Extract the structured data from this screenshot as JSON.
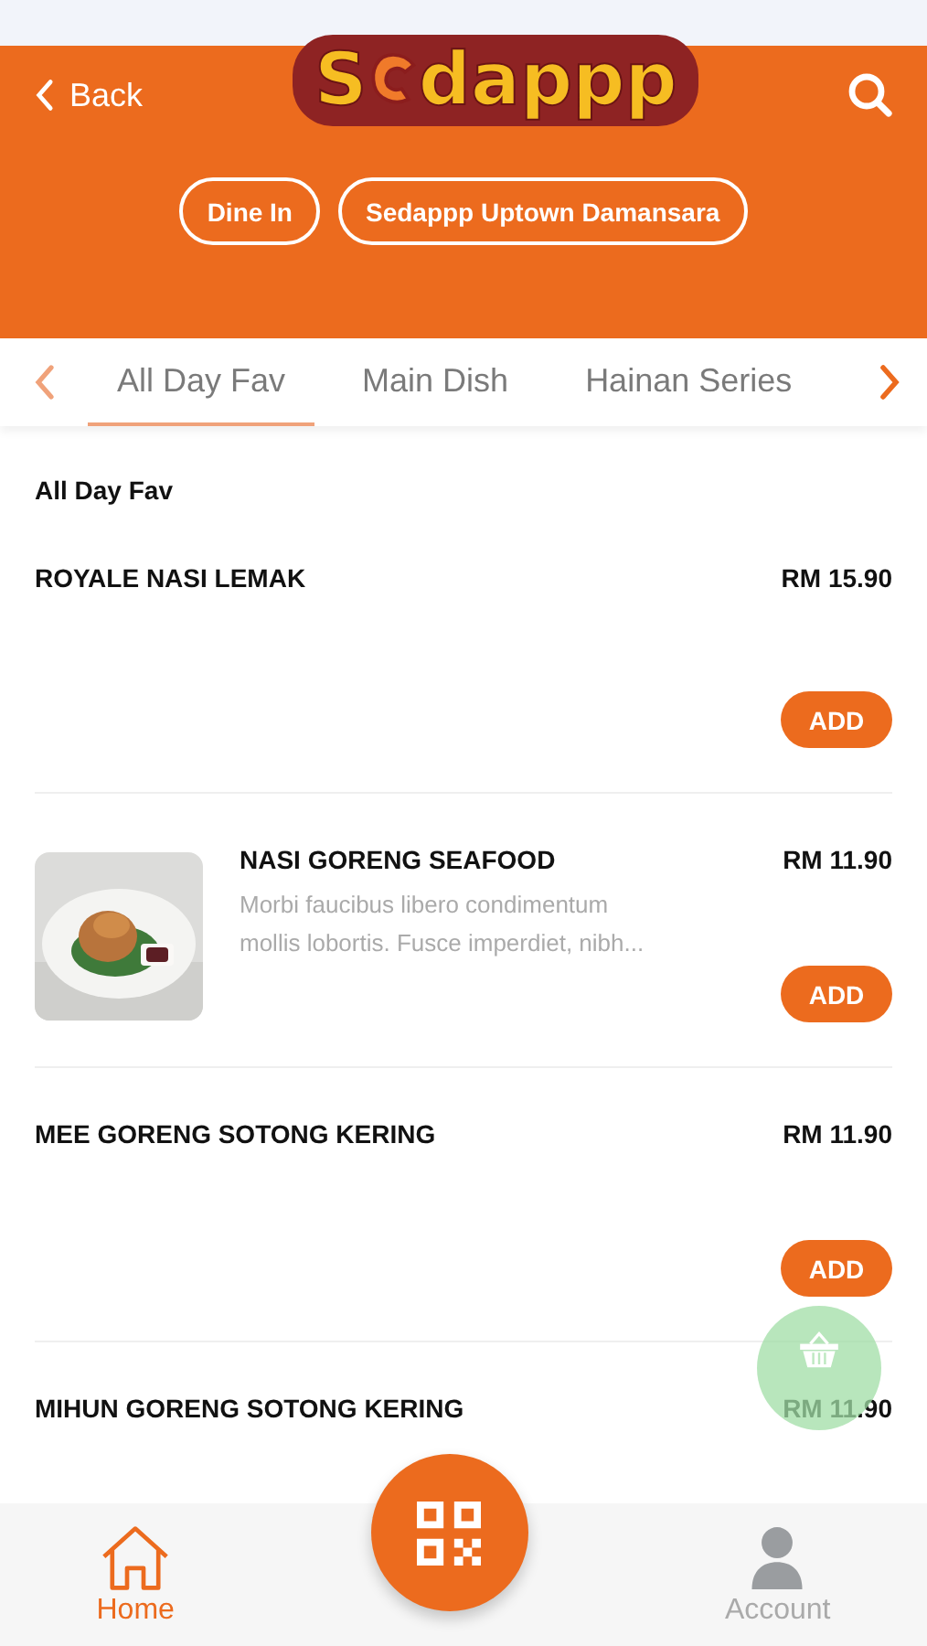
{
  "header": {
    "back_label": "Back",
    "logo": {
      "start": "S",
      "end": "dappp"
    },
    "pills": [
      "Dine In",
      "Sedappp Uptown Damansara"
    ]
  },
  "tabs": [
    {
      "label": "All Day Fav",
      "selected": true
    },
    {
      "label": "Main Dish",
      "selected": false
    },
    {
      "label": "Hainan Series",
      "selected": false
    }
  ],
  "section_title": "All Day Fav",
  "items": [
    {
      "kind": "plain",
      "name": "ROYALE NASI LEMAK",
      "price": "RM 15.90",
      "button": "ADD"
    },
    {
      "kind": "with_picture",
      "name": "NASI GORENG SEAFOOD",
      "price": "RM 11.90",
      "description": "Morbi faucibus libero condimentum mollis lobortis. Fusce imperdiet, nibh...",
      "button": "ADD"
    },
    {
      "kind": "plain",
      "name": "MEE GORENG SOTONG KERING",
      "price": "RM 11.90",
      "button": "ADD"
    },
    {
      "kind": "plain",
      "name": "MIHUN GORENG SOTONG KERING",
      "price": "RM 11.90"
    }
  ],
  "nav": [
    {
      "kind": "home",
      "label": "Home",
      "selected": true
    },
    {
      "kind": "scan"
    },
    {
      "kind": "account",
      "label": "Account",
      "selected": false
    }
  ]
}
